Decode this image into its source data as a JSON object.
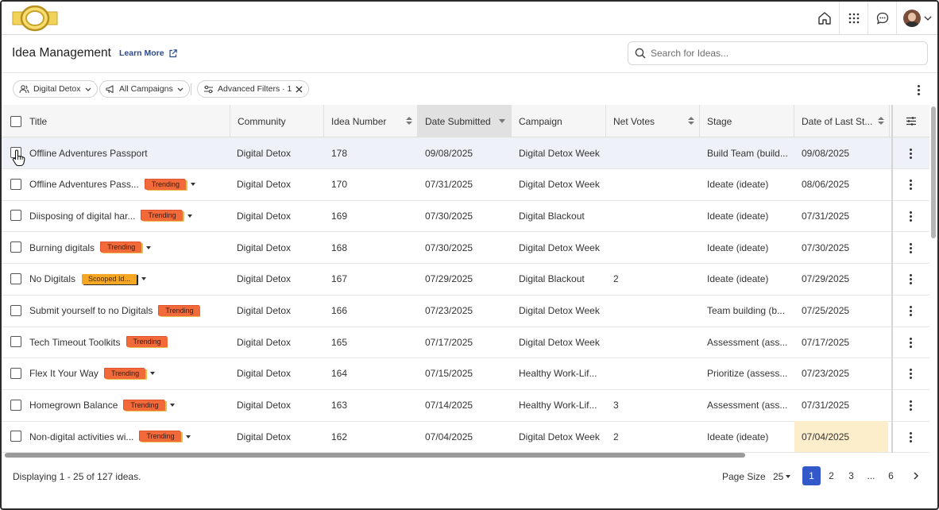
{
  "header": {
    "title": "Idea Management",
    "learn_more": "Learn More",
    "search_placeholder": "Search for Ideas..."
  },
  "filters": {
    "community": "Digital Detox",
    "campaigns": "All Campaigns",
    "advanced": "Advanced Filters · 1"
  },
  "table": {
    "columns": [
      "Title",
      "Community",
      "Idea Number",
      "Date Submitted",
      "Campaign",
      "Net Votes",
      "Stage",
      "Date of Last St..."
    ],
    "rows": [
      {
        "title": "Offline Adventures Passport",
        "badge": "",
        "community": "Digital Detox",
        "number": "178",
        "date": "09/08/2025",
        "campaign": "Digital Detox Week",
        "votes": "",
        "stage": "Build Team (build...",
        "last": "09/08/2025"
      },
      {
        "title": "Offline Adventures Pass...",
        "badge": "Trending",
        "community": "Digital Detox",
        "number": "170",
        "date": "07/31/2025",
        "campaign": "Digital Detox Week",
        "votes": "",
        "stage": "Ideate (ideate)",
        "last": "08/06/2025"
      },
      {
        "title": "Diisposing of digital har...",
        "badge": "Trending",
        "community": "Digital Detox",
        "number": "169",
        "date": "07/30/2025",
        "campaign": "Digital Blackout",
        "votes": "",
        "stage": "Ideate (ideate)",
        "last": "07/31/2025"
      },
      {
        "title": "Burning digitals",
        "badge": "Trending",
        "community": "Digital Detox",
        "number": "168",
        "date": "07/30/2025",
        "campaign": "Digital Detox Week",
        "votes": "",
        "stage": "Ideate (ideate)",
        "last": "07/30/2025"
      },
      {
        "title": "No Digitals",
        "badge": "Scooped Id...",
        "community": "Digital Detox",
        "number": "167",
        "date": "07/29/2025",
        "campaign": "Digital Blackout",
        "votes": "2",
        "stage": "Ideate (ideate)",
        "last": "07/29/2025"
      },
      {
        "title": "Submit yourself to no Digitals",
        "badge": "Trending",
        "community": "Digital Detox",
        "number": "166",
        "date": "07/23/2025",
        "campaign": "Digital Detox Week",
        "votes": "",
        "stage": "Team building (b...",
        "last": "07/25/2025"
      },
      {
        "title": "Tech Timeout Toolkits",
        "badge": "Trending",
        "community": "Digital Detox",
        "number": "165",
        "date": "07/17/2025",
        "campaign": "Digital Detox Week",
        "votes": "",
        "stage": "Assessment (ass...",
        "last": "07/17/2025"
      },
      {
        "title": "Flex It Your Way",
        "badge": "Trending",
        "community": "Digital Detox",
        "number": "164",
        "date": "07/15/2025",
        "campaign": "Healthy Work-Lif...",
        "votes": "",
        "stage": "Prioritize (assess...",
        "last": "07/23/2025"
      },
      {
        "title": "Homegrown Balance",
        "badge": "Trending",
        "community": "Digital Detox",
        "number": "163",
        "date": "07/14/2025",
        "campaign": "Healthy Work-Lif...",
        "votes": "3",
        "stage": "Assessment (ass...",
        "last": "07/31/2025"
      },
      {
        "title": "Non-digital activities wi...",
        "badge": "Trending",
        "community": "Digital Detox",
        "number": "162",
        "date": "07/04/2025",
        "campaign": "Digital Detox Week",
        "votes": "2",
        "stage": "Ideate (ideate)",
        "last": "07/04/2025"
      }
    ]
  },
  "footer": {
    "display_text": "Displaying 1 - 25 of 127 ideas.",
    "page_size_label": "Page Size",
    "page_size": "25",
    "pages": [
      "1",
      "2",
      "3",
      "...",
      "6"
    ],
    "active_page": "1"
  },
  "colors": {
    "accent": "#3358c9",
    "trending_badge": "#f26a3a",
    "scooped_badge": "#f5a623",
    "selected_row": "#eef2f8",
    "highlight_cell": "#fdeecb"
  },
  "icons": [
    "home-icon",
    "apps-grid-icon",
    "chat-icon",
    "external-link-icon",
    "search-icon",
    "users-icon",
    "megaphone-icon",
    "sliders-icon",
    "close-icon",
    "column-settings-icon",
    "more-vertical-icon",
    "chevron-right-icon"
  ]
}
